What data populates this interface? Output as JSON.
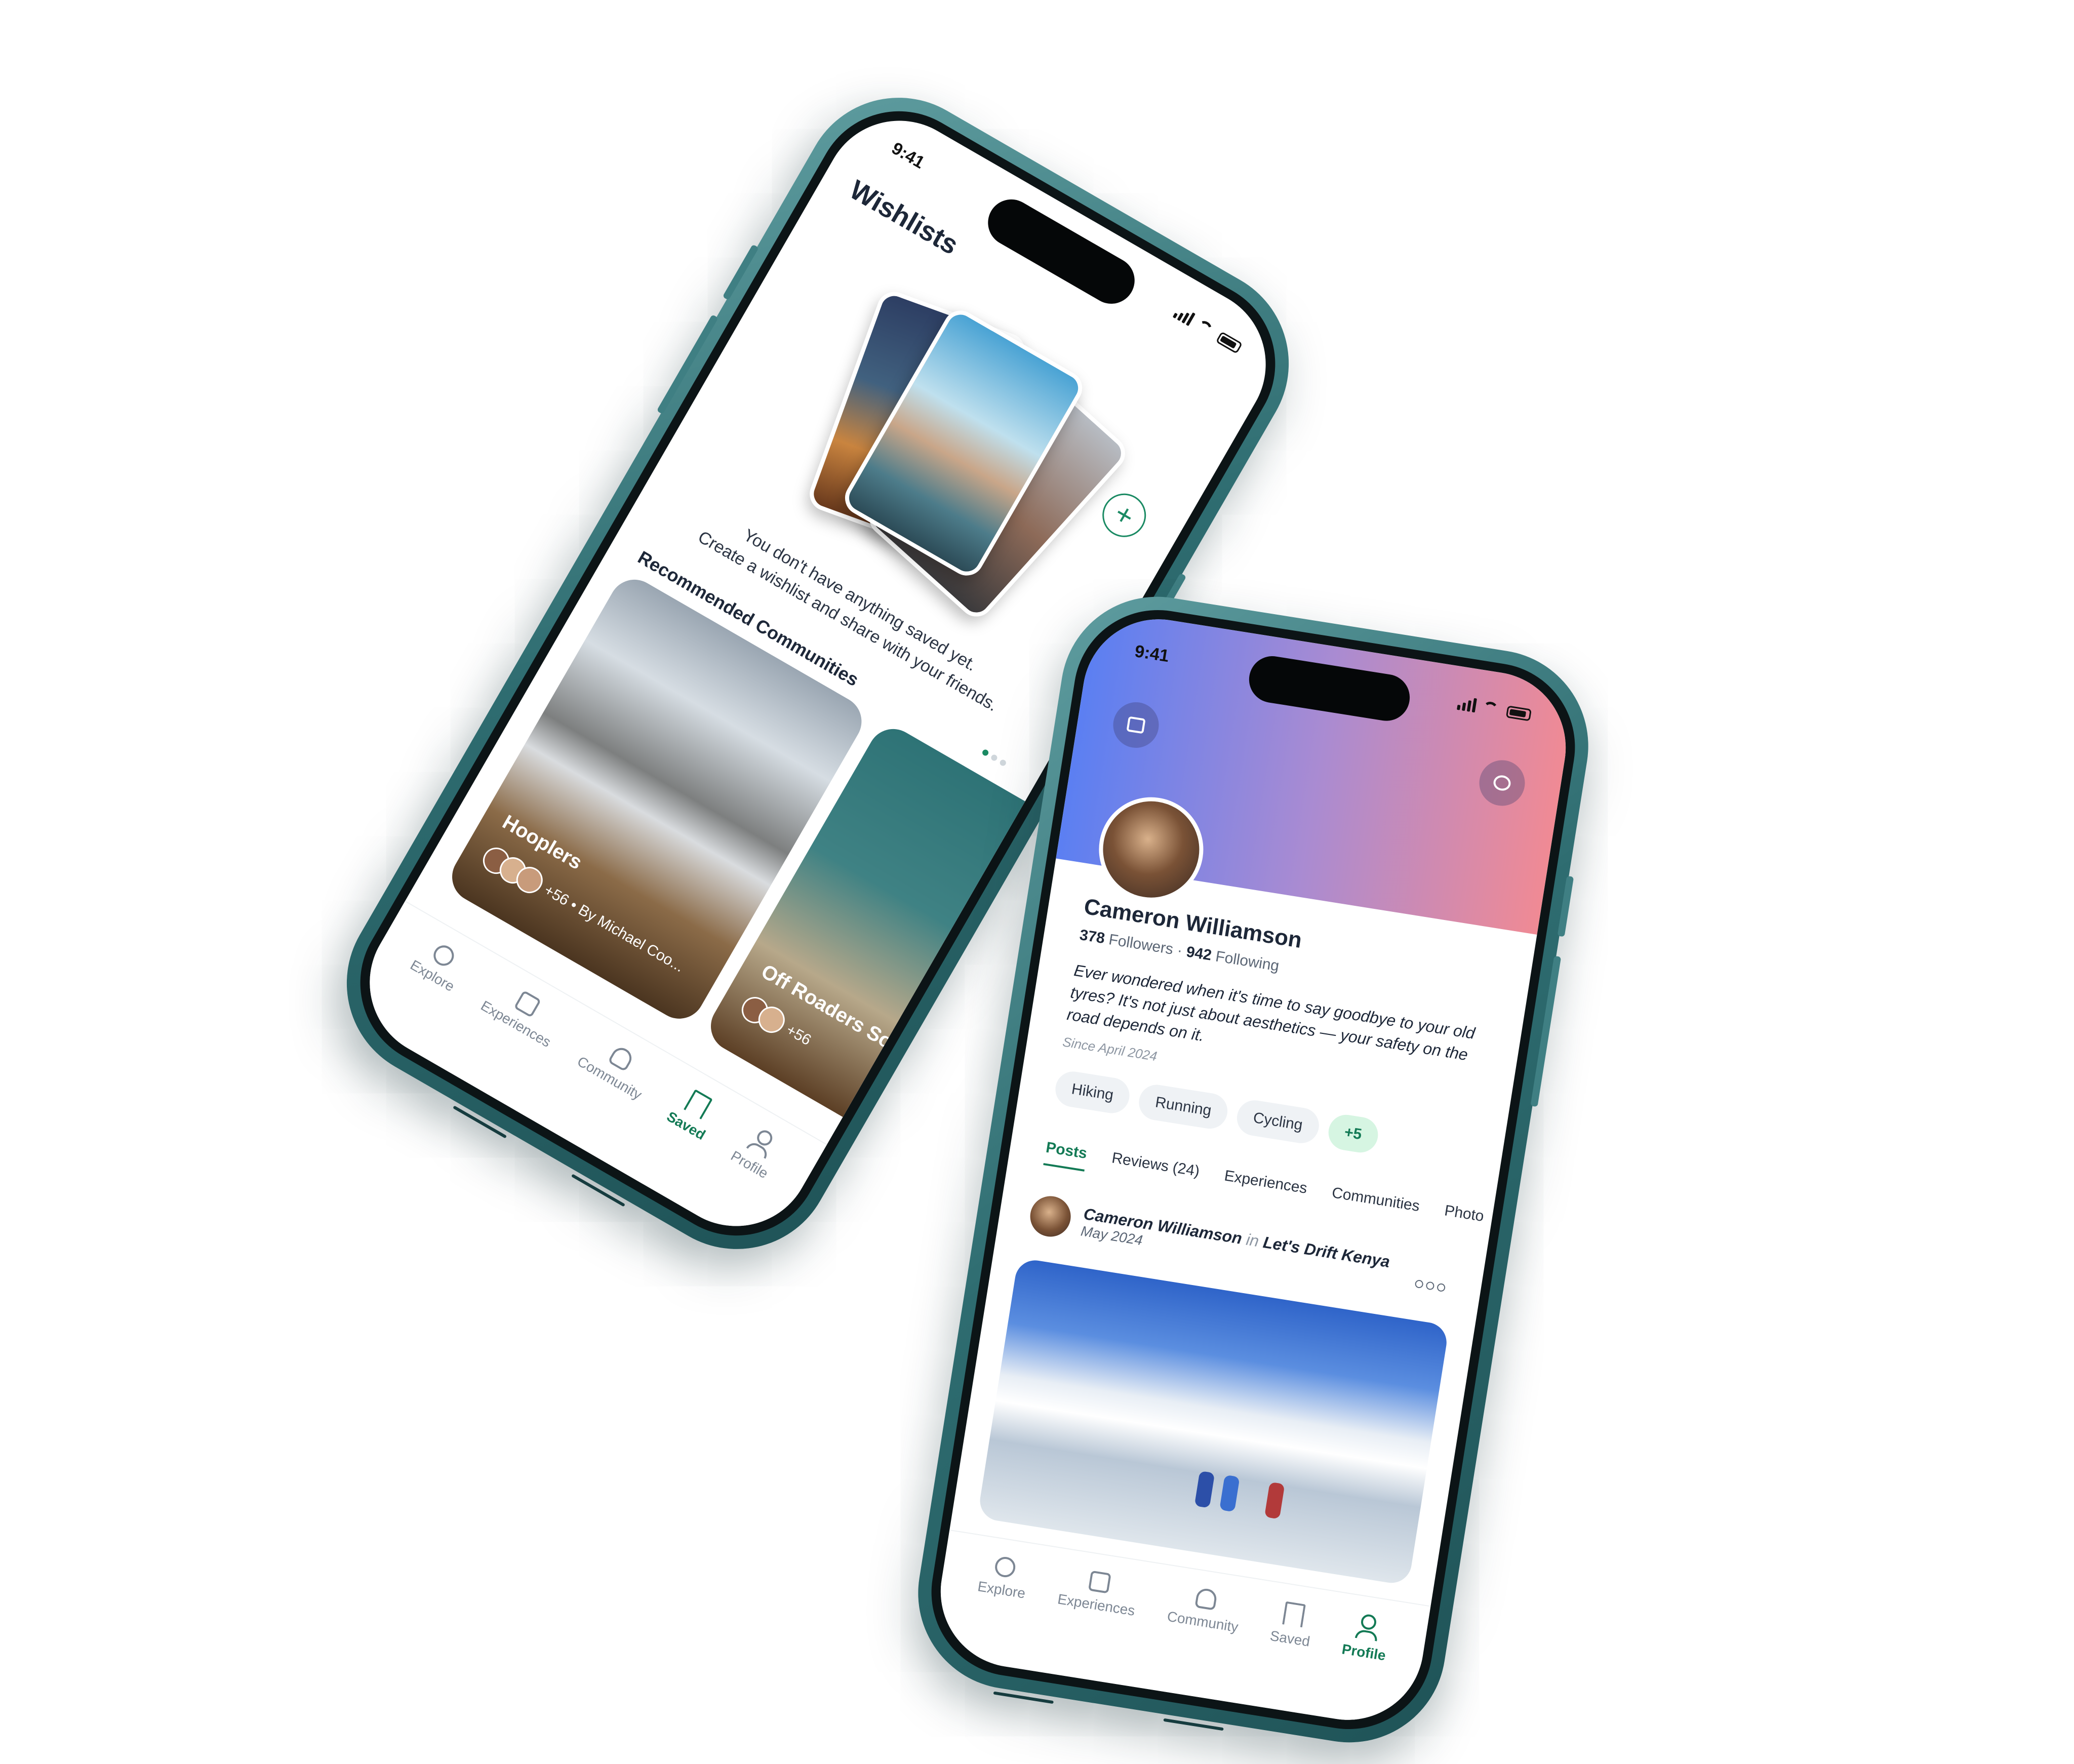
{
  "wishlists_screen": {
    "status_time": "9:41",
    "title": "Wishlists",
    "add_button": "+",
    "empty_line1": "You don't have anything saved yet.",
    "empty_line2": "Create a wishlist and share with your friends.",
    "recommended_title": "Recommended Communities",
    "communities": [
      {
        "name": "Hooplers",
        "meta": "+56 • By Michael Coo..."
      },
      {
        "name": "Off Roaders Soc",
        "meta": "+56"
      }
    ]
  },
  "profile_screen": {
    "status_time": "9:41",
    "name": "Cameron Williamson",
    "followers_count": "378",
    "followers_label": "Followers",
    "following_count": "942",
    "following_label": "Following",
    "bio": "Ever wondered when it's time to say goodbye to your old tyres? It's not just about aesthetics — your safety on the road depends on it.",
    "since": "Since April 2024",
    "interests": [
      "Hiking",
      "Running",
      "Cycling"
    ],
    "interests_more": "+5",
    "tabs": [
      "Posts",
      "Reviews (24)",
      "Experiences",
      "Communities",
      "Photo"
    ],
    "active_tab": "Posts",
    "post": {
      "author": "Cameron Williamson",
      "in_word": "in",
      "community": "Let's Drift Kenya",
      "date": "May 2024"
    }
  },
  "tabbar": {
    "items": [
      "Explore",
      "Experiences",
      "Community",
      "Saved",
      "Profile"
    ]
  },
  "colors": {
    "accent": "#137a55",
    "banner_start": "#5b7ff2",
    "banner_end": "#f08a94",
    "phone_frame": "#2e6c70"
  }
}
